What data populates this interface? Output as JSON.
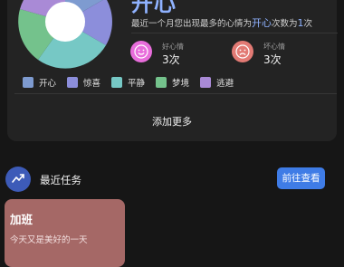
{
  "mood_card": {
    "top_mood": "开心",
    "summary_prefix": "最近一个月您出现最多的心情为",
    "summary_mood": "开心",
    "summary_middle": "次数为",
    "summary_count": "1",
    "summary_suffix": "次",
    "good": {
      "label": "好心情",
      "count": "3次",
      "color": "#e86ddb"
    },
    "bad": {
      "label": "坏心情",
      "count": "3次",
      "color": "#e27a74"
    },
    "legend": [
      {
        "label": "开心",
        "color": "#7e9bd0"
      },
      {
        "label": "惊喜",
        "color": "#8c8edb"
      },
      {
        "label": "平静",
        "color": "#76c8c5"
      },
      {
        "label": "梦境",
        "color": "#74c28c"
      },
      {
        "label": "逃避",
        "color": "#a98ad6"
      }
    ],
    "add_more": "添加更多"
  },
  "tasks": {
    "title": "最近任务",
    "goto_button": "前往查看",
    "card": {
      "title": "加班",
      "text": "今天又是美好的一天",
      "color": "#a56866"
    }
  },
  "colors": {
    "accent": "#8fb2ff",
    "button": "#3f7ce6",
    "background": "#161616",
    "card": "#232323"
  }
}
